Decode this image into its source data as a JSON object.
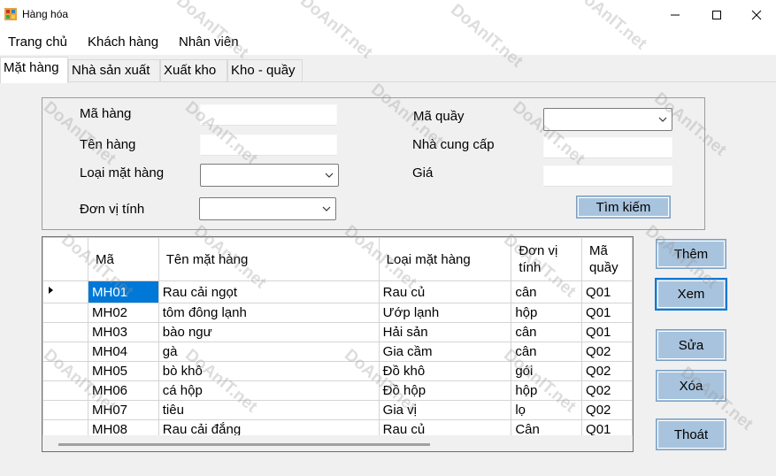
{
  "window": {
    "title": "Hàng hóa"
  },
  "menu": {
    "items": [
      "Trang chủ",
      "Khách hàng",
      "Nhân viên"
    ]
  },
  "tabs": [
    "Mặt hàng",
    "Nhà sản xuất",
    "Xuất kho",
    "Kho - quầy"
  ],
  "form": {
    "ma_hang_label": "Mã hàng",
    "ten_hang_label": "Tên hàng",
    "loai_mat_hang_label": "Loại mặt hàng",
    "don_vi_tinh_label": "Đơn vị tính",
    "ma_quay_label": "Mã quầy",
    "nha_cung_cap_label": "Nhà cung cấp",
    "gia_label": "Giá",
    "search_button": "Tìm kiếm"
  },
  "buttons": {
    "them": "Thêm",
    "xem": "Xem",
    "sua": "Sửa",
    "xoa": "Xóa",
    "thoat": "Thoát"
  },
  "grid": {
    "columns": [
      "Mã",
      "Tên mặt hàng",
      "Loại mặt hàng",
      "Đơn vị tính",
      "Mã quầy"
    ],
    "rows": [
      [
        "MH01",
        "Rau cải ngọt",
        "Rau củ",
        "cân",
        "Q01"
      ],
      [
        "MH02",
        "tôm đông lạnh",
        "Ướp lạnh",
        "hộp",
        "Q01"
      ],
      [
        "MH03",
        "bào ngư",
        "Hải sản",
        "cân",
        "Q01"
      ],
      [
        "MH04",
        "gà",
        "Gia cầm",
        "cân",
        "Q02"
      ],
      [
        "MH05",
        "bò khô",
        "Đồ khô",
        "gói",
        "Q02"
      ],
      [
        "MH06",
        "cá hộp",
        "Đồ hộp",
        "hộp",
        "Q02"
      ],
      [
        "MH07",
        "tiêu",
        "Gia vị",
        "lọ",
        "Q02"
      ],
      [
        "MH08",
        "Rau cải đắng",
        "Rau củ",
        "Cân",
        "Q01"
      ]
    ]
  },
  "watermark": "DoAnIT.net",
  "colors": {
    "button_bg": "#a8c3dd",
    "selection": "#0078d7"
  }
}
